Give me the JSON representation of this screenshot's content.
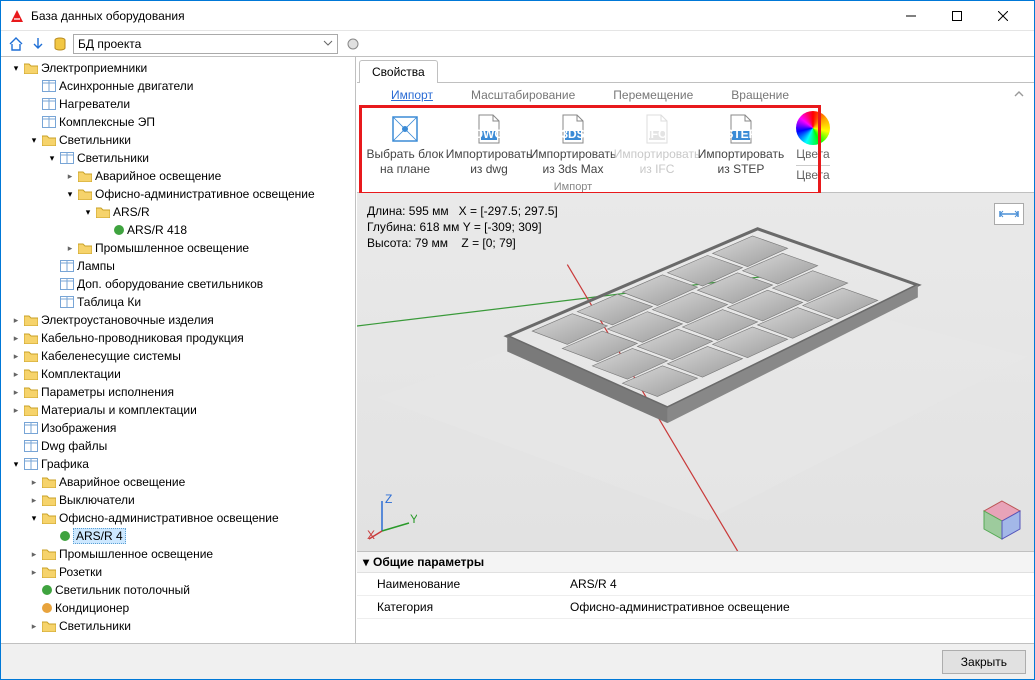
{
  "window": {
    "title": "База данных оборудования"
  },
  "toolbar": {
    "combo": "БД проекта"
  },
  "tabs": {
    "properties": "Свойства"
  },
  "ribbon": {
    "tabs": {
      "import": "Импорт",
      "scale": "Масштабирование",
      "move": "Перемещение",
      "rotate": "Вращение"
    },
    "buttons": {
      "select_block": {
        "l1": "Выбрать блок",
        "l2": "на плане"
      },
      "import_dwg": {
        "l1": "Импортировать",
        "l2": "из dwg"
      },
      "import_3ds": {
        "l1": "Импортировать",
        "l2": "из 3ds Max"
      },
      "import_ifc": {
        "l1": "Импортировать",
        "l2": "из IFC"
      },
      "import_step": {
        "l1": "Импортировать",
        "l2": "из STEP"
      }
    },
    "group_label": "Импорт",
    "colors": {
      "l1": "Цвета",
      "l2": "Цвета"
    }
  },
  "dimensions": {
    "len": "Длина: 595 мм",
    "len_x": "X = [-297.5; 297.5]",
    "dep": "Глубина: 618 мм",
    "dep_y": "Y = [-309; 309]",
    "h": "Высота: 79 мм",
    "h_z": "Z = [0; 79]"
  },
  "tree": {
    "root": "Электроприемники",
    "async_motors": "Асинхронные двигатели",
    "heaters": "Нагреватели",
    "complex": "Комплексные ЭП",
    "lights": "Светильники",
    "lights_sub": "Светильники",
    "emerg": "Аварийное освещение",
    "office": "Офисно-административное освещение",
    "arsr": "ARS/R",
    "arsr418": "ARS/R 418",
    "industrial": "Промышленное освещение",
    "lamps": "Лампы",
    "addl": "Доп. оборудование светильников",
    "ki": "Таблица Ки",
    "install": "Электроустановочные изделия",
    "cable_prod": "Кабельно-проводниковая продукция",
    "cable_sys": "Кабеленесущие системы",
    "complect": "Комплектации",
    "exec_params": "Параметры исполнения",
    "materials": "Материалы и комплектации",
    "images": "Изображения",
    "dwg": "Dwg файлы",
    "graphics": "Графика",
    "g_emerg": "Аварийное освещение",
    "g_switch": "Выключатели",
    "g_office": "Офисно-административное освещение",
    "arsr4": "ARS/R 4",
    "g_industrial": "Промышленное освещение",
    "g_sockets": "Розетки",
    "g_ceiling": "Светильник потолочный",
    "g_cond": "Кондиционер",
    "g_lights": "Светильники"
  },
  "props": {
    "header": "Общие параметры",
    "name_k": "Наименование",
    "name_v": "ARS/R 4",
    "cat_k": "Категория",
    "cat_v": "Офисно-административное освещение"
  },
  "footer": {
    "close": "Закрыть"
  }
}
